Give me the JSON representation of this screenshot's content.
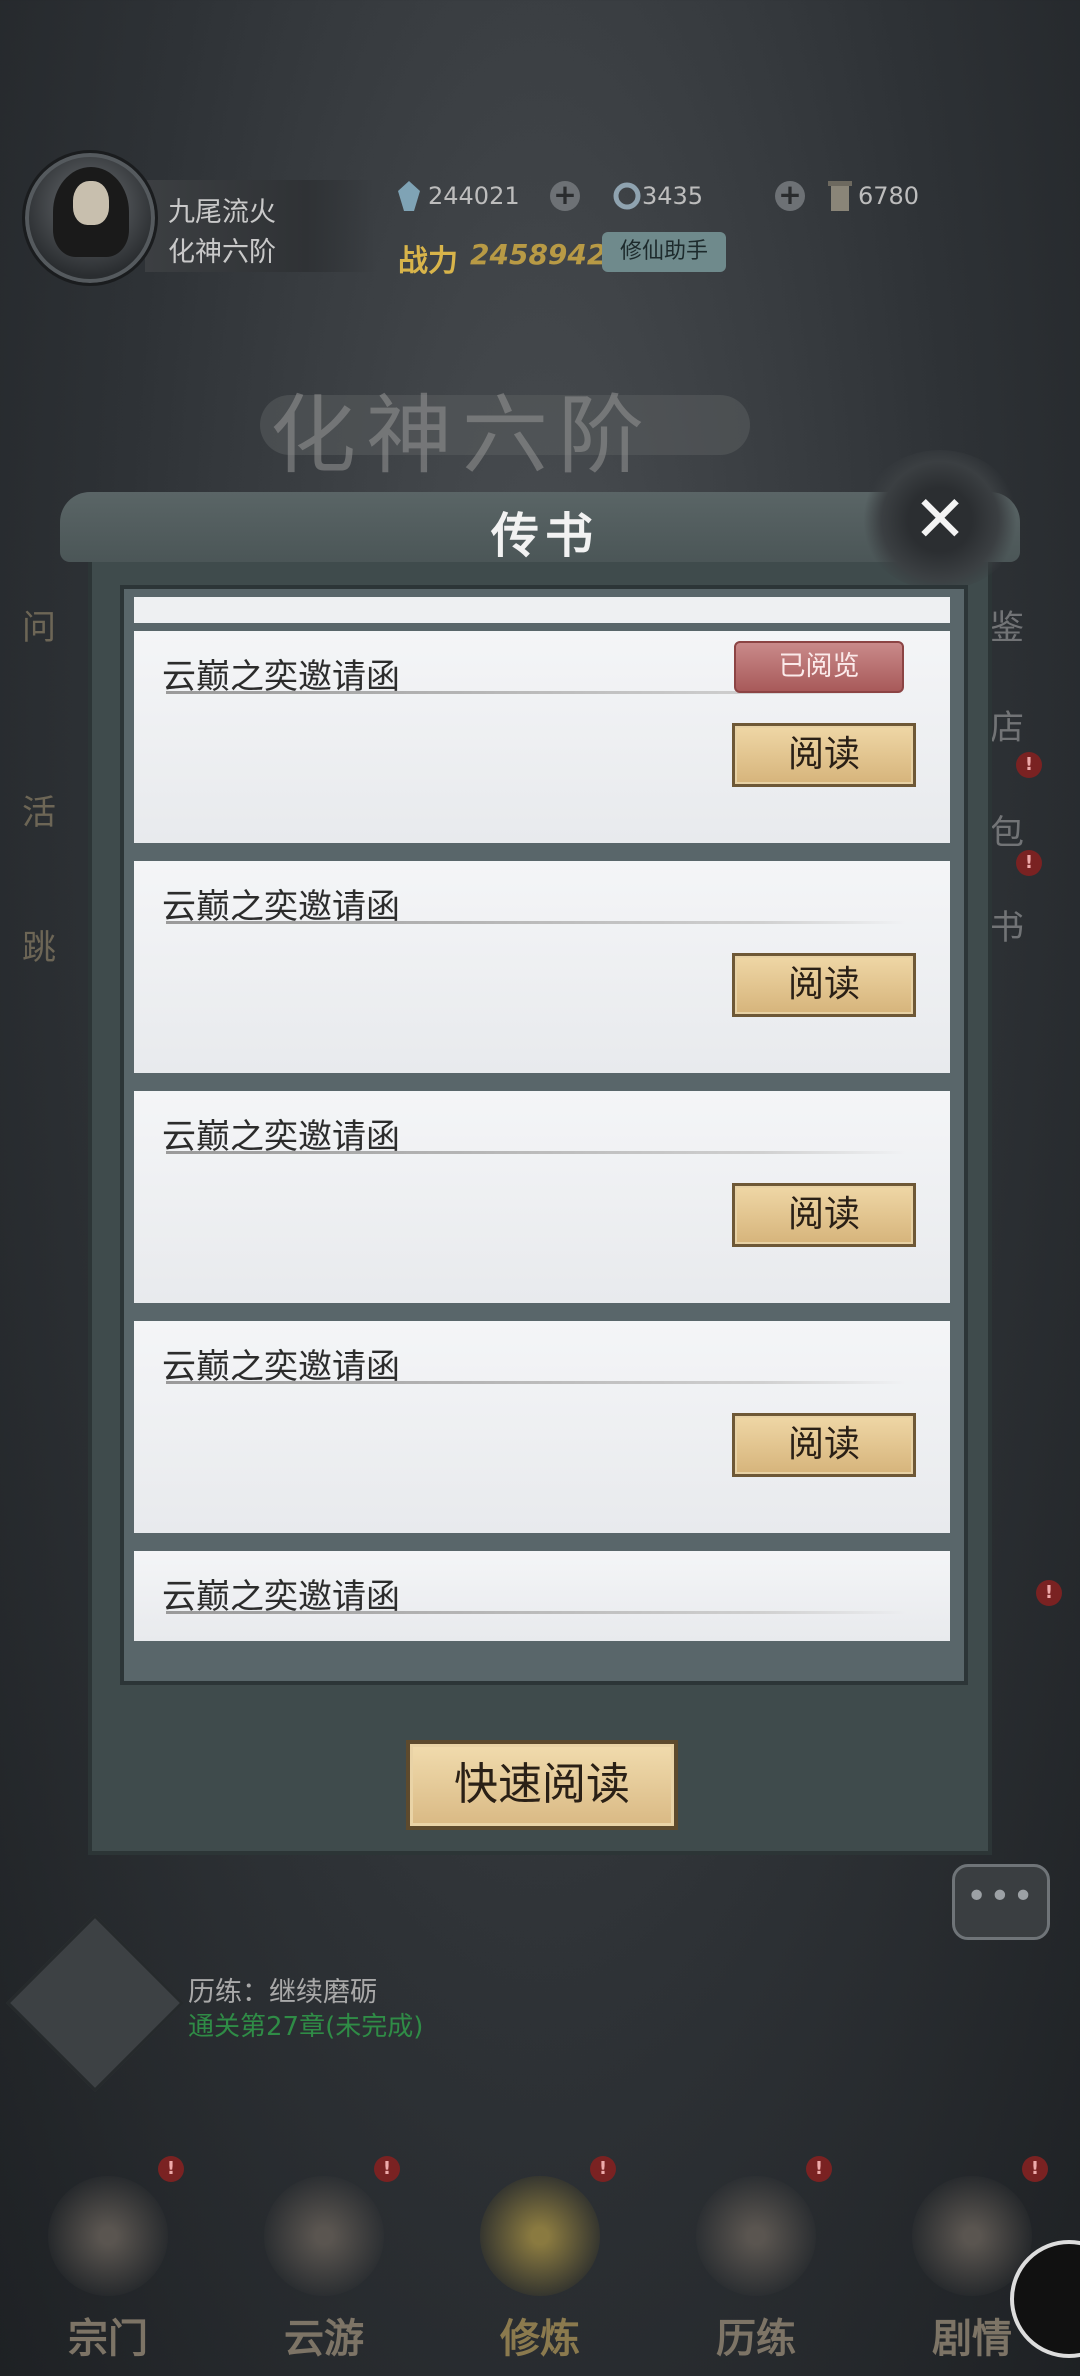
{
  "player": {
    "name": "九尾流火",
    "rank": "化神六阶",
    "power_label": "战力",
    "power_value": "2458942",
    "helper_label": "修仙助手"
  },
  "resources": [
    {
      "icon": "crystal-icon",
      "value": "244021"
    },
    {
      "icon": "ring-icon",
      "value": "3435"
    },
    {
      "icon": "scroll-icon",
      "value": "6780"
    }
  ],
  "background": {
    "realm_title": "化神六阶",
    "left_labels": [
      "问",
      "活",
      "跳"
    ],
    "right_labels": [
      "鉴",
      "店",
      "包",
      "书"
    ]
  },
  "dialog": {
    "title": "传书",
    "close_icon": "close-icon",
    "read_badge": "已阅览",
    "read_button": "阅读",
    "quick_read_button": "快速阅读",
    "mails": [
      {
        "title": "云巅之奕邀请函",
        "read": true
      },
      {
        "title": "云巅之奕邀请函",
        "read": false
      },
      {
        "title": "云巅之奕邀请函",
        "read": false
      },
      {
        "title": "云巅之奕邀请函",
        "read": false
      },
      {
        "title": "云巅之奕邀请函",
        "read": false
      }
    ]
  },
  "task": {
    "label": "历练：继续磨砺",
    "progress": "通关第27章(未完成)"
  },
  "bottom_nav": [
    {
      "label": "宗门",
      "badge": "!"
    },
    {
      "label": "云游",
      "badge": "!"
    },
    {
      "label": "修炼",
      "badge": "!"
    },
    {
      "label": "历练",
      "badge": "!"
    },
    {
      "label": "剧情",
      "badge": "!"
    }
  ],
  "colors": {
    "accent_gold": "#d6b47b",
    "read_badge": "#a85a5a",
    "progress_green": "#2f8c46"
  }
}
